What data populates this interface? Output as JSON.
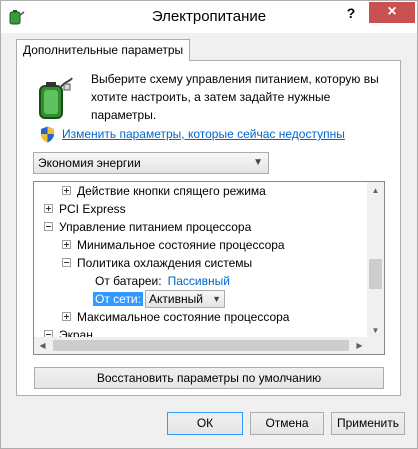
{
  "window": {
    "title": "Электропитание",
    "help_label": "?",
    "close_label": "×"
  },
  "tabs": [
    {
      "label": "Дополнительные параметры"
    }
  ],
  "panel": {
    "description": "Выберите схему управления питанием, которую вы хотите настроить, а затем задайте нужные параметры.",
    "change_link": "Изменить параметры, которые сейчас недоступны",
    "scheme_select": {
      "value": "Экономия энергии"
    }
  },
  "tree": {
    "rows": [
      {
        "label": "Действие кнопки спящего режима",
        "expander": "plus"
      },
      {
        "label": "PCI Express",
        "expander": "plus"
      },
      {
        "label": "Управление питанием процессора",
        "expander": "minus"
      },
      {
        "label": "Минимальное состояние процессора",
        "expander": "plus"
      },
      {
        "label": "Политика охлаждения системы",
        "expander": "minus"
      },
      {
        "label": "Максимальное состояние процессора",
        "expander": "plus"
      },
      {
        "label": "Экран",
        "expander": "minus"
      }
    ],
    "on_battery": {
      "label": "От батареи:",
      "value": "Пассивный"
    },
    "plugged_in": {
      "label": "От сети:",
      "value": "Активный"
    }
  },
  "buttons": {
    "restore": "Восстановить параметры по умолчанию",
    "ok": "ОК",
    "cancel": "Отмена",
    "apply": "Применить"
  },
  "colors": {
    "link": "#0066cc",
    "selection": "#3399ff",
    "close": "#c75050"
  }
}
